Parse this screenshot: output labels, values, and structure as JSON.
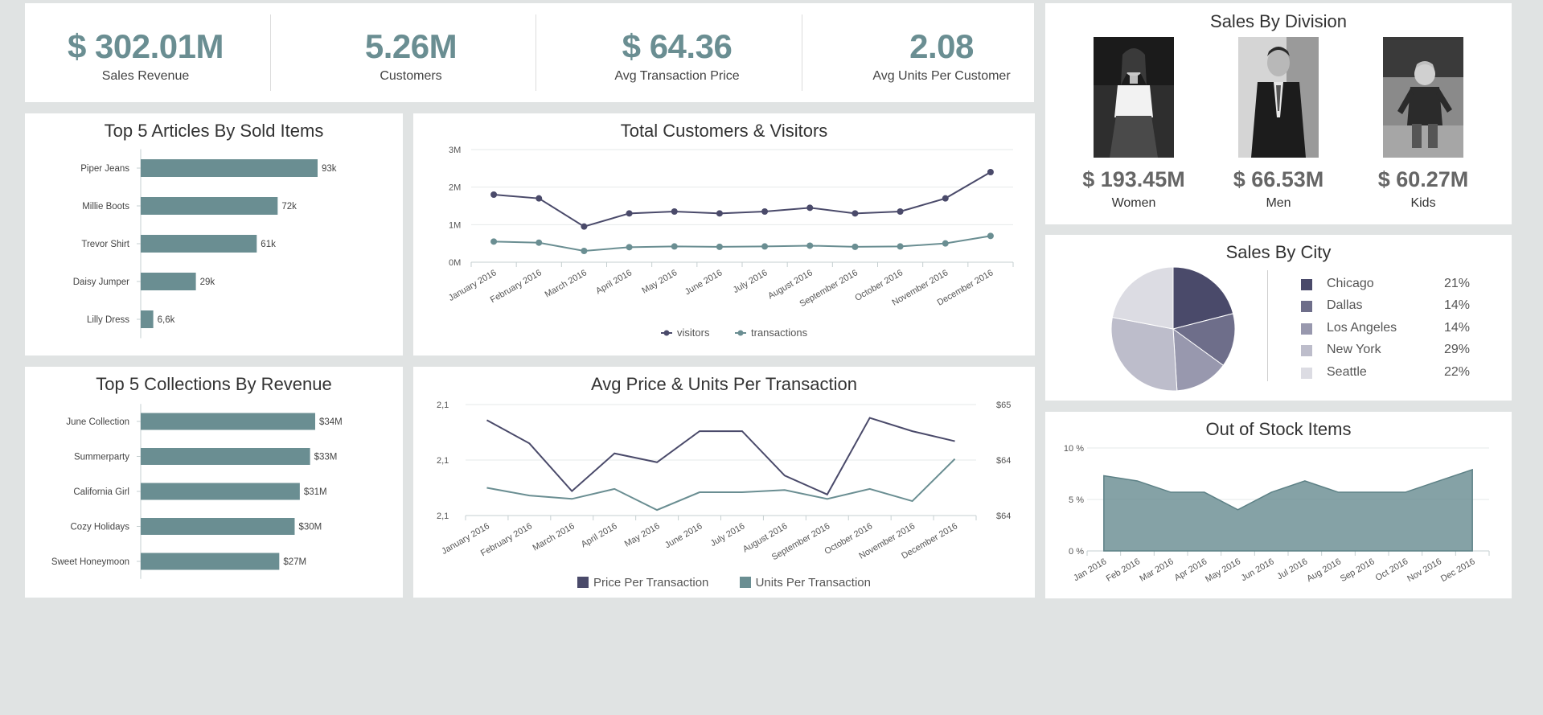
{
  "kpis": [
    {
      "value": "$ 302.01M",
      "label": "Sales Revenue"
    },
    {
      "value": "5.26M",
      "label": "Customers"
    },
    {
      "value": "$ 64.36",
      "label": "Avg Transaction Price"
    },
    {
      "value": "2.08",
      "label": "Avg Units Per Customer"
    }
  ],
  "division": {
    "title": "Sales By Division",
    "items": [
      {
        "value": "$ 193.45M",
        "label": "Women"
      },
      {
        "value": "$ 66.53M",
        "label": "Men"
      },
      {
        "value": "$ 60.27M",
        "label": "Kids"
      }
    ]
  },
  "colors": {
    "teal": "#6a8e92",
    "navy": "#4a4a6a",
    "background": "#e0e3e3",
    "pie": [
      "#4a4a6a",
      "#6e6e8a",
      "#9898ae",
      "#bdbdcb",
      "#dcdce3"
    ]
  },
  "chart_data": [
    {
      "id": "articles",
      "type": "bar",
      "orientation": "horizontal",
      "title": "Top 5 Articles By Sold Items",
      "categories": [
        "Piper Jeans",
        "Millie Boots",
        "Trevor Shirt",
        "Daisy Jumper",
        "Lilly Dress"
      ],
      "values": [
        93000,
        72000,
        61000,
        29000,
        6600
      ],
      "data_labels": [
        "93k",
        "72k",
        "61k",
        "29k",
        "6,6k"
      ],
      "color": "#6a8e92"
    },
    {
      "id": "visitors",
      "type": "line",
      "title": "Total Customers & Visitors",
      "x": [
        "January 2016",
        "February 2016",
        "March 2016",
        "April 2016",
        "May 2016",
        "June 2016",
        "July 2016",
        "August 2016",
        "September 2016",
        "October 2016",
        "November 2016",
        "December 2016"
      ],
      "y_ticks": [
        "0M",
        "1M",
        "2M",
        "3M"
      ],
      "ylim": [
        0,
        3000000
      ],
      "series": [
        {
          "name": "visitors",
          "color": "#4a4a6a",
          "values": [
            1800000,
            1700000,
            950000,
            1300000,
            1350000,
            1300000,
            1350000,
            1450000,
            1300000,
            1350000,
            1700000,
            2400000
          ]
        },
        {
          "name": "transactions",
          "color": "#6a8e92",
          "values": [
            550000,
            520000,
            300000,
            400000,
            420000,
            410000,
            420000,
            440000,
            410000,
            420000,
            500000,
            700000
          ]
        }
      ],
      "legend": "bottom"
    },
    {
      "id": "collections",
      "type": "bar",
      "orientation": "horizontal",
      "title": "Top 5 Collections By Revenue",
      "categories": [
        "June Collection",
        "Summerparty",
        "California Girl",
        "Cozy Holidays",
        "Sweet Honeymoon"
      ],
      "values": [
        34,
        33,
        31,
        30,
        27
      ],
      "data_labels": [
        "$34M",
        "$33M",
        "$31M",
        "$30M",
        "$27M"
      ],
      "color": "#6a8e92"
    },
    {
      "id": "avgprice",
      "type": "line",
      "title": "Avg Price & Units Per Transaction",
      "x": [
        "January 2016",
        "February 2016",
        "March 2016",
        "April 2016",
        "May 2016",
        "June 2016",
        "July 2016",
        "August 2016",
        "September 2016",
        "October 2016",
        "November 2016",
        "December 2016"
      ],
      "y_left_ticks": [
        "2,1",
        "2,1",
        "2,1"
      ],
      "y_right_ticks": [
        "$64",
        "$64",
        "$65"
      ],
      "series": [
        {
          "name": "Price Per Transaction",
          "color": "#4a4a6a",
          "axis": "left",
          "values": [
            0.86,
            0.65,
            0.22,
            0.56,
            0.48,
            0.76,
            0.76,
            0.36,
            0.19,
            0.88,
            0.76,
            0.67
          ]
        },
        {
          "name": "Units Per Transaction",
          "color": "#6a8e92",
          "axis": "right",
          "values": [
            0.25,
            0.18,
            0.15,
            0.24,
            0.05,
            0.21,
            0.21,
            0.23,
            0.15,
            0.24,
            0.13,
            0.51
          ]
        }
      ],
      "legend": "bottom"
    },
    {
      "id": "city",
      "type": "pie",
      "title": "Sales By City",
      "labels": [
        "Chicago",
        "Dallas",
        "Los Angeles",
        "New York",
        "Seattle"
      ],
      "values": [
        21,
        14,
        14,
        29,
        22
      ],
      "pct_labels": [
        "21%",
        "14%",
        "14%",
        "29%",
        "22%"
      ],
      "legend": "right"
    },
    {
      "id": "stock",
      "type": "area",
      "title": "Out of Stock Items",
      "x": [
        "Jan 2016",
        "Feb 2016",
        "Mar 2016",
        "Apr 2016",
        "May 2016",
        "Jun 2016",
        "Jul 2016",
        "Aug 2016",
        "Sep 2016",
        "Oct 2016",
        "Nov 2016",
        "Dec 2016"
      ],
      "y_ticks": [
        "0 %",
        "5 %",
        "10 %"
      ],
      "ylim": [
        0,
        10
      ],
      "values": [
        7.3,
        6.8,
        5.7,
        5.7,
        4.0,
        5.7,
        6.8,
        5.7,
        5.7,
        5.7,
        6.8,
        7.9
      ],
      "color": "#6a8e92"
    }
  ]
}
